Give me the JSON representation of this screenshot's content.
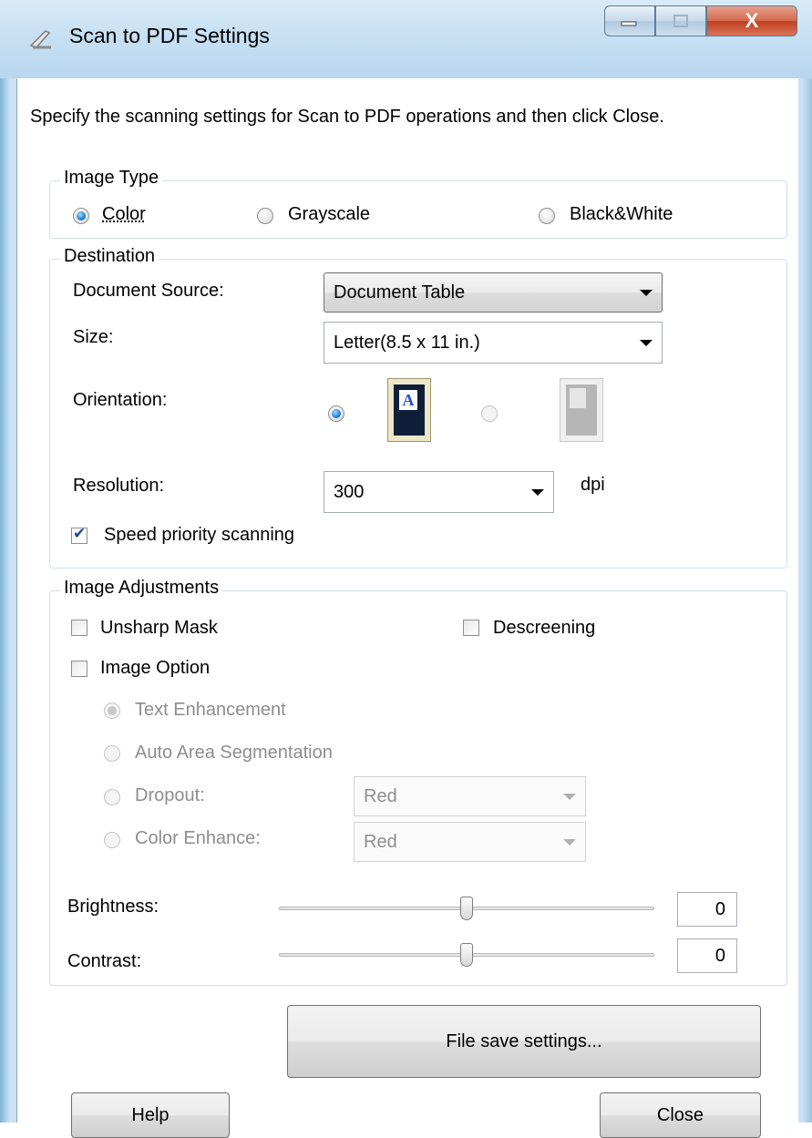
{
  "window": {
    "title": "Scan to PDF Settings",
    "close_glyph": "X"
  },
  "intro": "Specify the scanning settings for Scan to PDF operations and then click Close.",
  "image_type": {
    "label": "Image Type",
    "options": [
      {
        "label": "Color",
        "selected": true
      },
      {
        "label": "Grayscale",
        "selected": false
      },
      {
        "label": "Black&White",
        "selected": false
      }
    ]
  },
  "destination": {
    "label": "Destination",
    "document_source": {
      "label": "Document Source:",
      "value": "Document Table"
    },
    "size": {
      "label": "Size:",
      "value": "Letter(8.5 x 11 in.)"
    },
    "orientation": {
      "label": "Orientation:",
      "portrait_selected": true,
      "portrait_letter": "A"
    },
    "resolution": {
      "label": "Resolution:",
      "value": "300",
      "unit": "dpi"
    },
    "speed_priority": {
      "label": "Speed priority scanning",
      "checked": true
    }
  },
  "adjustments": {
    "label": "Image Adjustments",
    "unsharp_mask": {
      "label": "Unsharp Mask",
      "checked": false
    },
    "descreening": {
      "label": "Descreening",
      "checked": false
    },
    "image_option": {
      "label": "Image Option",
      "checked": false
    },
    "text_enhancement": {
      "label": "Text Enhancement",
      "selected": true
    },
    "auto_area": {
      "label": "Auto Area Segmentation",
      "selected": false
    },
    "dropout": {
      "label": "Dropout:",
      "value": "Red",
      "selected": false
    },
    "color_enhance": {
      "label": "Color Enhance:",
      "value": "Red",
      "selected": false
    },
    "brightness": {
      "label": "Brightness:",
      "value": "0"
    },
    "contrast": {
      "label": "Contrast:",
      "value": "0"
    }
  },
  "buttons": {
    "file_save": "File save settings...",
    "help": "Help",
    "close": "Close"
  },
  "colors": {
    "accent": "#2a86d8",
    "disabled_text": "#8d8d8d",
    "frame": "#c9e2f4"
  }
}
